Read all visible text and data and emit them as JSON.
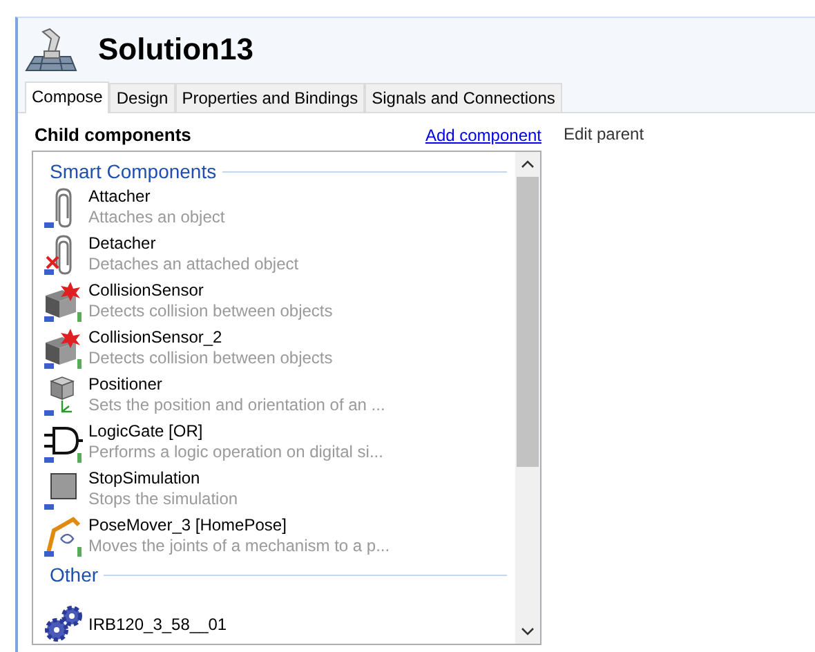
{
  "window": {
    "title": "Solution13"
  },
  "tabs": [
    {
      "label": "Compose",
      "selected": true
    },
    {
      "label": "Design",
      "selected": false
    },
    {
      "label": "Properties and Bindings",
      "selected": false
    },
    {
      "label": "Signals and Connections",
      "selected": false
    }
  ],
  "section": {
    "title": "Child components",
    "add_link": "Add component",
    "edit_link": "Edit parent"
  },
  "groups": [
    {
      "title": "Smart Components",
      "items": [
        {
          "kind": "attacher",
          "name": "Attacher",
          "description": "Attaches an object"
        },
        {
          "kind": "detacher",
          "name": "Detacher",
          "description": "Detaches an attached object"
        },
        {
          "kind": "sensor",
          "name": "CollisionSensor",
          "description": "Detects collision between objects"
        },
        {
          "kind": "sensor",
          "name": "CollisionSensor_2",
          "description": "Detects collision between objects"
        },
        {
          "kind": "positioner",
          "name": "Positioner",
          "description": "Sets the position and orientation of an ..."
        },
        {
          "kind": "gate",
          "name": "LogicGate [OR]",
          "description": "Performs a logic operation on digital si..."
        },
        {
          "kind": "stop",
          "name": "StopSimulation",
          "description": "Stops the simulation"
        },
        {
          "kind": "mover",
          "name": "PoseMover_3 [HomePose]",
          "description": "Moves the joints of a mechanism to a p..."
        }
      ]
    },
    {
      "title": "Other",
      "items": [
        {
          "kind": "gear",
          "name": "IRB120_3_58__01"
        }
      ]
    }
  ]
}
